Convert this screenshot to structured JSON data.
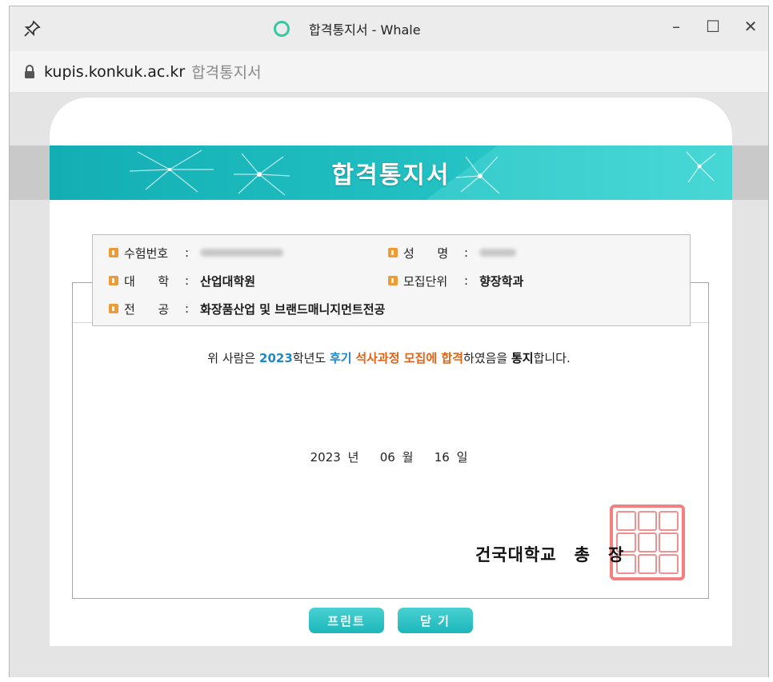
{
  "window": {
    "title": "합격통지서 - Whale",
    "controls": {
      "minimize": "–",
      "maximize": "☐",
      "close": "✕"
    }
  },
  "address": {
    "host": "kupis.konkuk.ac.kr",
    "page_title": "합격통지서"
  },
  "banner": {
    "title": "합격통지서"
  },
  "info": {
    "exam_no": {
      "label": "수험번호",
      "value": ""
    },
    "name": {
      "label": "성      명",
      "value": ""
    },
    "college": {
      "label": "대      학",
      "value": "산업대학원"
    },
    "unit": {
      "label": "모집단위",
      "value": "향장학과"
    },
    "major": {
      "label": "전      공",
      "value": "화장품산업 및 브랜드매니지먼트전공"
    },
    "colon": ":"
  },
  "notice": {
    "p1": "위 사람은 ",
    "year": "2023",
    "p2": "학년도 ",
    "term": "후기",
    "p3": " ",
    "course": "석사과정 모집에 합격",
    "p4": "하였음을 ",
    "notify": "통지",
    "p5": "합니다."
  },
  "date": {
    "year": "2023",
    "year_unit": "년",
    "month": "06",
    "month_unit": "월",
    "day": "16",
    "day_unit": "일"
  },
  "signature": {
    "school": "건국대학교",
    "title_1": "총",
    "title_2": "장"
  },
  "buttons": {
    "print": "프린트",
    "close": "닫 기"
  },
  "colors": {
    "accent": "#1cb6bb",
    "orange": "#e06316",
    "blue": "#1e88c8",
    "seal": "#ef6b6b"
  }
}
